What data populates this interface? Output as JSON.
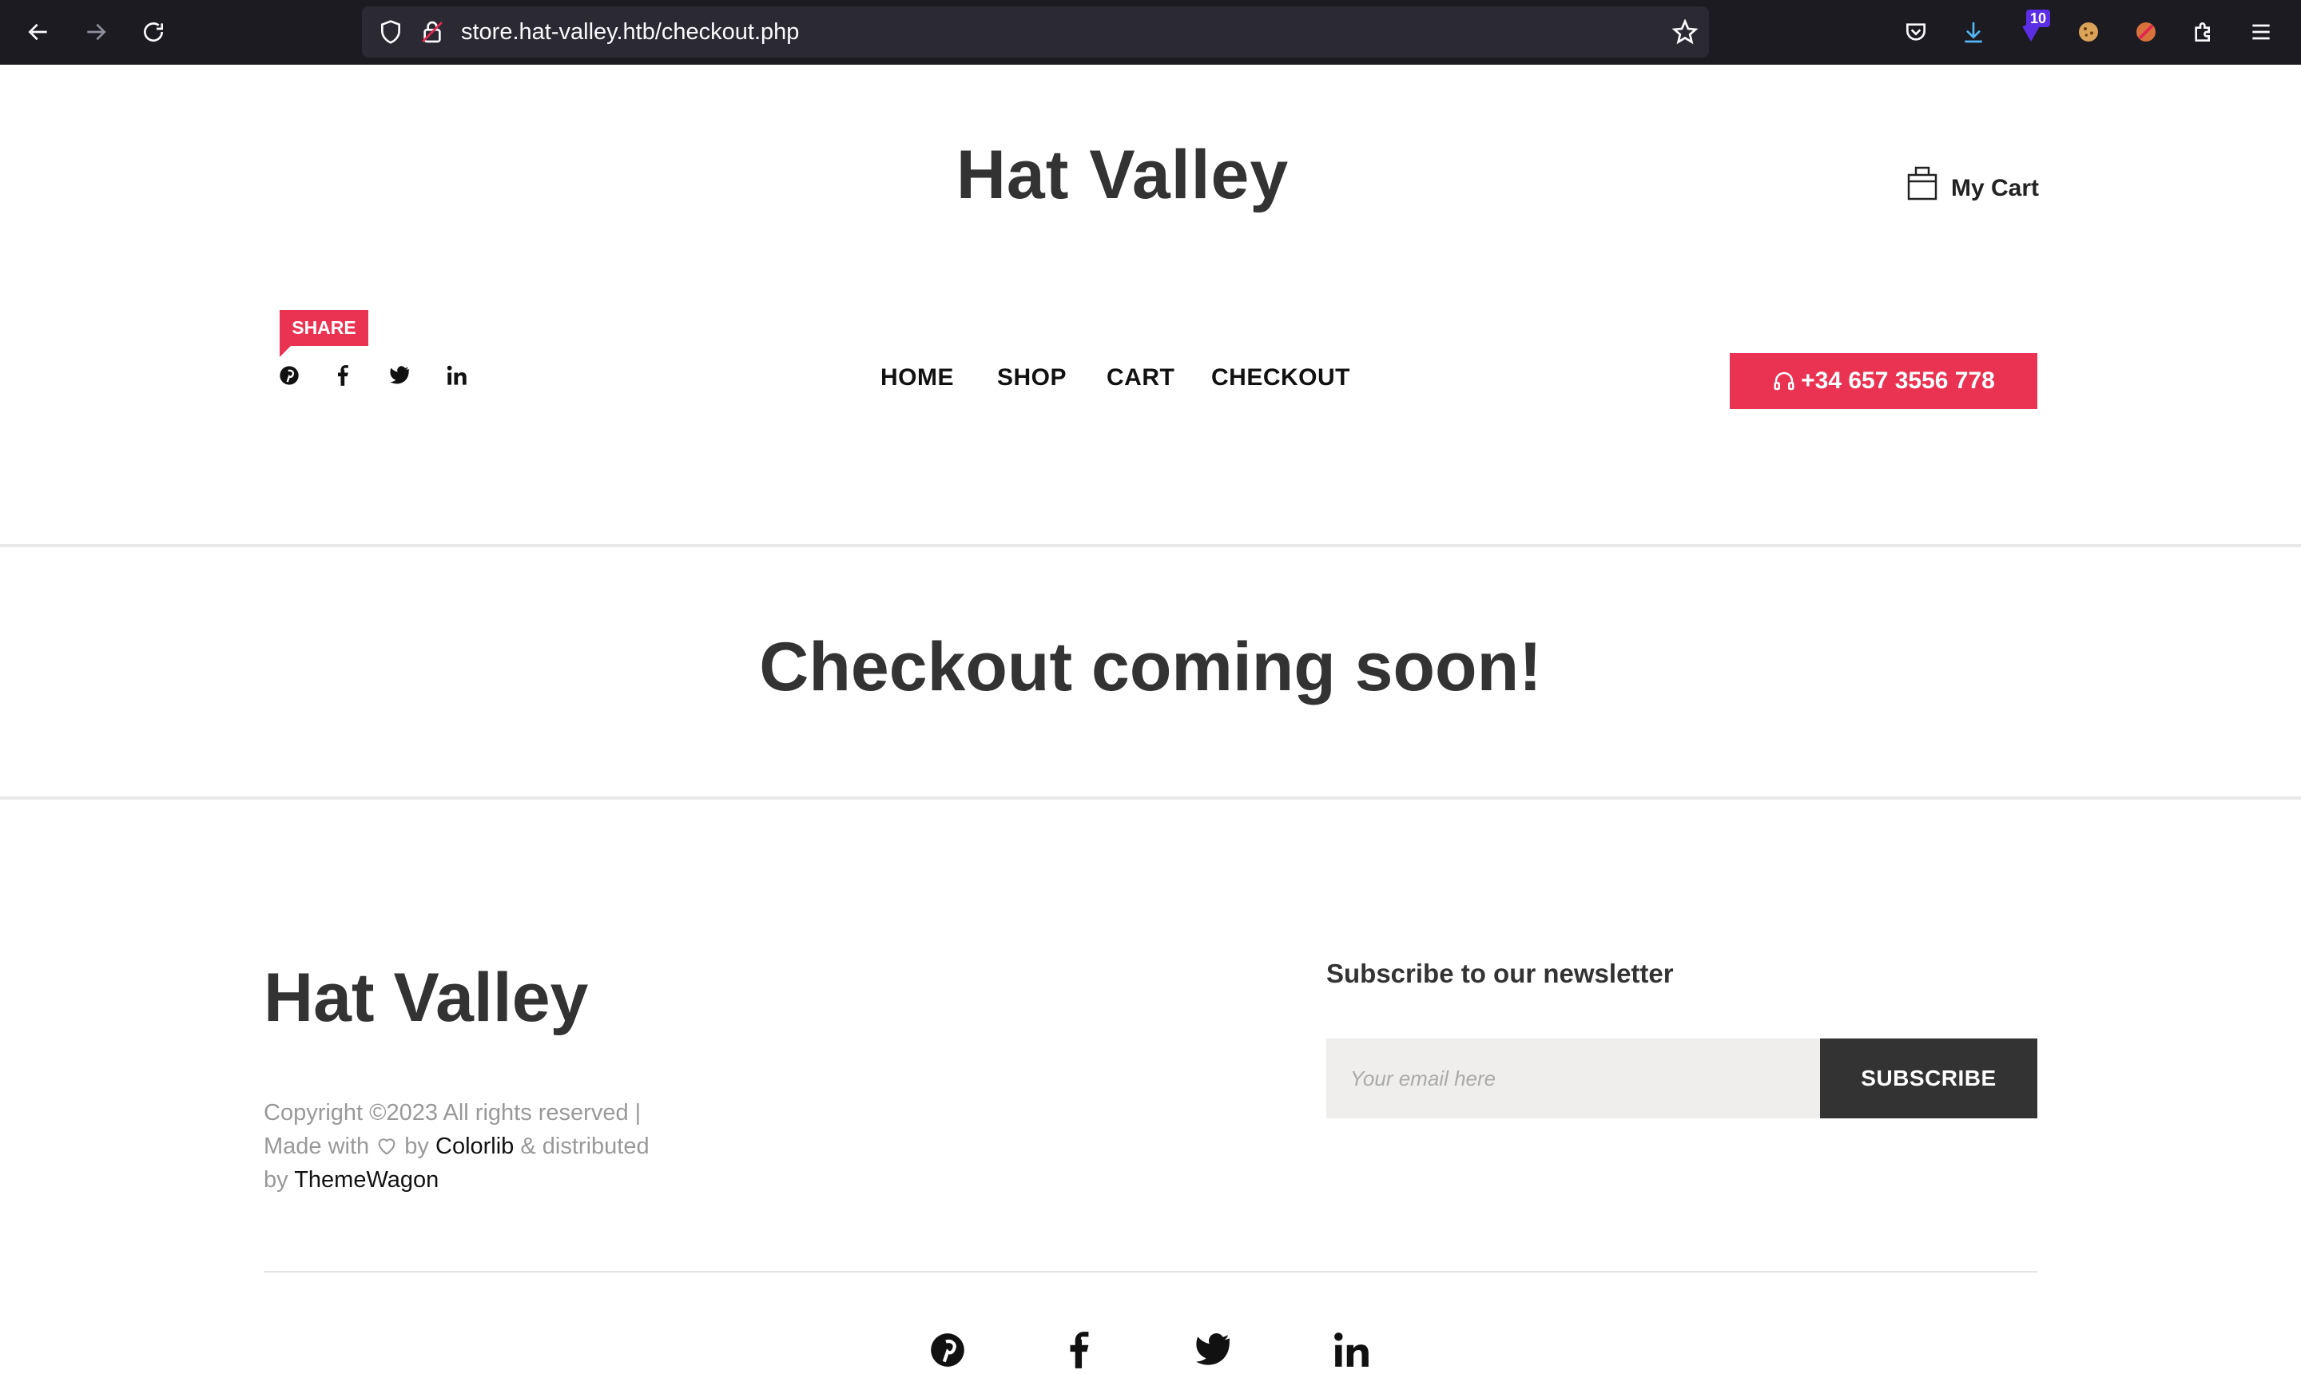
{
  "browser": {
    "url": "store.hat-valley.htb/checkout.php",
    "extension_badge": "10"
  },
  "header": {
    "title": "Hat Valley",
    "cart_label": "My Cart",
    "share_label": "SHARE",
    "phone": "+34 657 3556 778"
  },
  "nav": {
    "items": [
      "HOME",
      "SHOP",
      "CART",
      "CHECKOUT"
    ]
  },
  "main": {
    "headline": "Checkout coming soon!"
  },
  "footer": {
    "logo": "Hat Valley",
    "copyright_prefix": "Copyright ©2023 All rights reserved |",
    "made_with": "Made with",
    "by": "by",
    "colorlib": "Colorlib",
    "distributed": "& distributed",
    "by2": "by",
    "themewagon": "ThemeWagon",
    "newsletter_title": "Subscribe to our newsletter",
    "email_placeholder": "Your email here",
    "subscribe_label": "SUBSCRIBE"
  },
  "colors": {
    "accent": "#ea3352",
    "dark": "#333333",
    "browser_bg": "#1c1b22"
  },
  "icons": {
    "share": [
      "pinterest-icon",
      "facebook-icon",
      "twitter-icon",
      "linkedin-icon"
    ]
  }
}
